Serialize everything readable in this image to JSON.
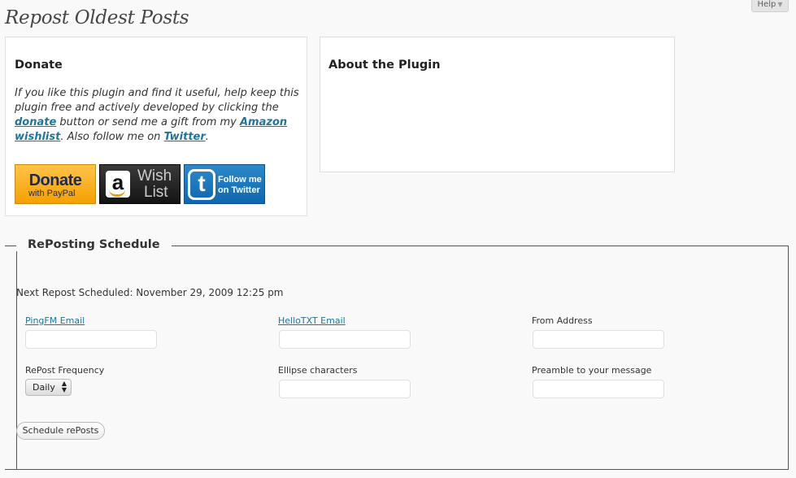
{
  "help_label": "Help",
  "page_title": "Repost Oldest Posts",
  "donate": {
    "title": "Donate",
    "text_1": "If you like this plugin and find it useful, help keep this plugin free and actively developed by clicking the ",
    "link_donate": "donate",
    "text_2": " button or send me a gift from my ",
    "link_wishlist": "Amazon wishlist",
    "text_3": ". Also follow me on ",
    "link_twitter": "Twitter",
    "text_4": ".",
    "paypal_big": "Donate",
    "paypal_small": "with PayPal",
    "amazon_logo": "a",
    "amazon_w1": "Wish",
    "amazon_w2": "List",
    "twitter_logo": "t",
    "twitter_f1": "Follow me",
    "twitter_f2": "on Twitter"
  },
  "about": {
    "title": "About the Plugin"
  },
  "schedule": {
    "legend": "RePosting Schedule",
    "next_info": "Next Repost Scheduled: November 29, 2009 12:25 pm",
    "fields": {
      "pingfm": "PingFM Email",
      "hellotxt": "HelloTXT Email",
      "from": "From Address",
      "frequency": "RePost Frequency",
      "ellipse": "Ellipse characters",
      "preamble": "Preamble to your message"
    },
    "frequency_value": "Daily",
    "submit_label": "Schedule rePosts"
  },
  "colors": {
    "link": "#21759b",
    "paypal": "#f5a000",
    "twitter": "#0f67b0"
  },
  "icons": [
    "paypal-logo-icon",
    "amazon-logo-icon",
    "twitter-logo-icon",
    "select-arrows-icon"
  ]
}
